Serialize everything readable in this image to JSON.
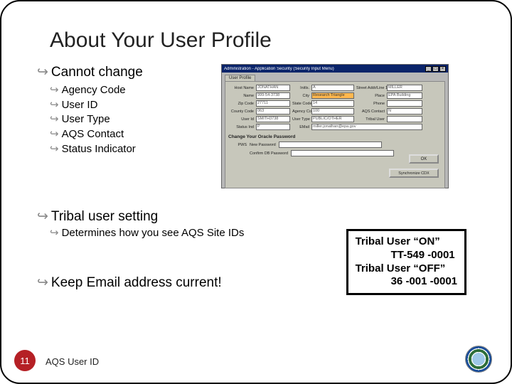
{
  "title": "About Your User Profile",
  "bullets": {
    "top": "Cannot change",
    "sub": [
      "Agency Code",
      "User ID",
      "User Type",
      "AQS Contact",
      "Status Indicator"
    ]
  },
  "tribal": {
    "head": "Tribal user setting",
    "sub": "Determines how you see AQS Site IDs"
  },
  "keep": "Keep Email address current!",
  "callout": {
    "on_label": "Tribal User “ON”",
    "on_value": "TT-549 -0001",
    "off_label": "Tribal User “OFF”",
    "off_value": "36 -001 -0001"
  },
  "win": {
    "title": "Administration - Application Security (Security Input Menu)",
    "tab": "User Profile",
    "labels": {
      "host": "Host Name",
      "name": "Name",
      "zip": "Zip Code",
      "county": "County Code",
      "userid": "User Id",
      "initl": "Initls.",
      "city": "City",
      "state": "State Code",
      "agency": "Agency Code",
      "user_type": "User Type",
      "street1": "Street Addr/Line 1",
      "street2": "Place",
      "phone": "Phone",
      "aqs": "AQS Contact",
      "status": "Status Ind",
      "email": "EMail",
      "tribal": "Tribal User"
    },
    "values": {
      "host": "JONATHAN",
      "name": "999-54-3738",
      "zip": "27711",
      "county": "063",
      "userid": "SMITH3738",
      "city": "Research Triangle",
      "state": "14",
      "agency": "100",
      "user_type": "PUBLIC/OTHER",
      "street1": "EPA Building",
      "street2": "MILLER",
      "phone": "",
      "aqs": "N",
      "status": "P",
      "email": "miller.jonathan@epa.gov",
      "initl": "A",
      "tribal": ""
    },
    "section": "Change Your Oracle Password",
    "pws_label": "PWS",
    "pws_hint": "New Password",
    "confirm_label": "",
    "confirm_hint": "Confirm DB Password",
    "ok": "OK",
    "sync": "Synchronize CDX"
  },
  "page_number": "11",
  "footer": "AQS User ID"
}
